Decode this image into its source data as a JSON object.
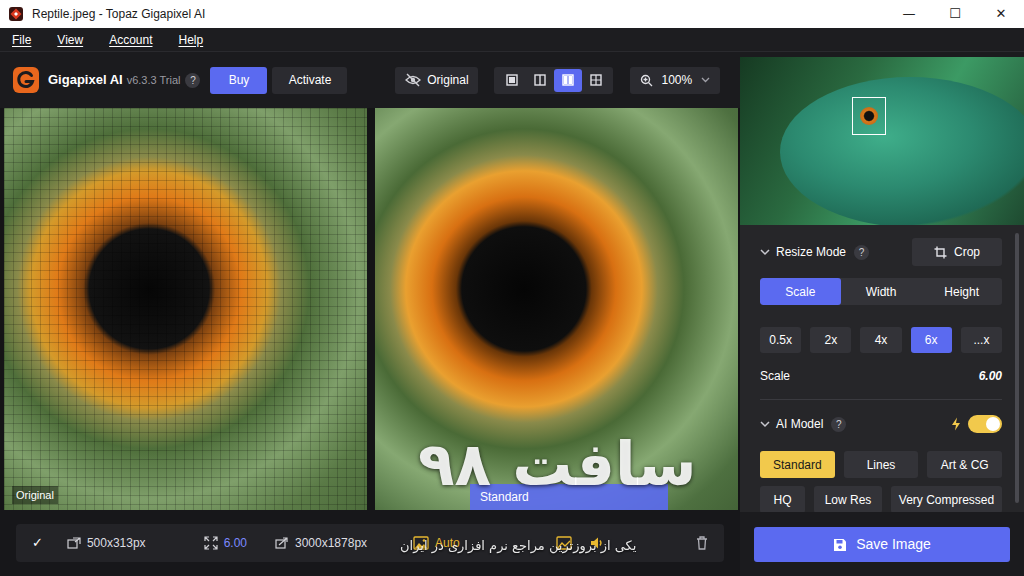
{
  "window": {
    "title": "Reptile.jpeg - Topaz Gigapixel AI",
    "controls": [
      "—",
      "☐",
      "✕"
    ]
  },
  "menu": [
    "File",
    "View",
    "Account",
    "Help"
  ],
  "toolbar": {
    "app_name": "Gigapixel AI",
    "version": "v6.3.3 Trial",
    "help": "?",
    "buy": "Buy",
    "activate": "Activate",
    "original": "Original",
    "view_modes": [
      {
        "selected": false
      },
      {
        "selected": false
      },
      {
        "selected": true
      },
      {
        "selected": false
      }
    ],
    "zoom": "100%"
  },
  "preview": {
    "before_label": "Original",
    "after_label": "Standard"
  },
  "panel": {
    "resize_mode": {
      "title": "Resize Mode",
      "help": "?",
      "expanded": true,
      "crop": "Crop",
      "tabs": [
        {
          "label": "Scale",
          "selected": true
        },
        {
          "label": "Width",
          "selected": false
        },
        {
          "label": "Height",
          "selected": false
        }
      ],
      "scales": [
        {
          "label": "0.5x",
          "selected": false
        },
        {
          "label": "2x",
          "selected": false
        },
        {
          "label": "4x",
          "selected": false
        },
        {
          "label": "6x",
          "selected": true
        },
        {
          "label": "...x",
          "selected": false
        }
      ],
      "scale_label": "Scale",
      "scale_value": "6.00"
    },
    "ai_model": {
      "title": "AI Model",
      "help": "?",
      "expanded": true,
      "auto": {
        "on": true
      },
      "models": [
        {
          "label": "Standard",
          "selected": true
        },
        {
          "label": "Lines",
          "selected": false
        },
        {
          "label": "Art & CG",
          "selected": false
        },
        {
          "label": "HQ",
          "selected": false
        },
        {
          "label": "Low Res",
          "selected": false
        },
        {
          "label": "Very Compressed",
          "selected": false
        }
      ]
    },
    "save": "Save Image"
  },
  "status_bar": {
    "done": "✓",
    "input_size": "500x313px",
    "scale": "6.00",
    "output_size": "3000x1878px",
    "auto": "Auto"
  },
  "watermark": {
    "brand": "سافت ۹۸",
    "tagline": "یکی از بروزترین مراجع نرم افزاری در ایران"
  }
}
